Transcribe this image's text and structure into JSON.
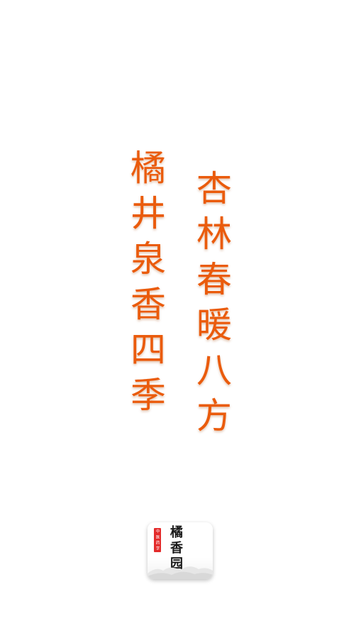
{
  "poem": {
    "left_column": [
      "橘",
      "井",
      "泉",
      "香",
      "四",
      "季"
    ],
    "right_column": [
      "杏",
      "林",
      "春",
      "暖",
      "八",
      "方"
    ],
    "color": "#ea5b0c"
  },
  "logo": {
    "seal_text": [
      "中",
      "医",
      "药",
      "学"
    ],
    "name": [
      "橘",
      "香",
      "园"
    ],
    "seal_color": "#e32b2b"
  }
}
